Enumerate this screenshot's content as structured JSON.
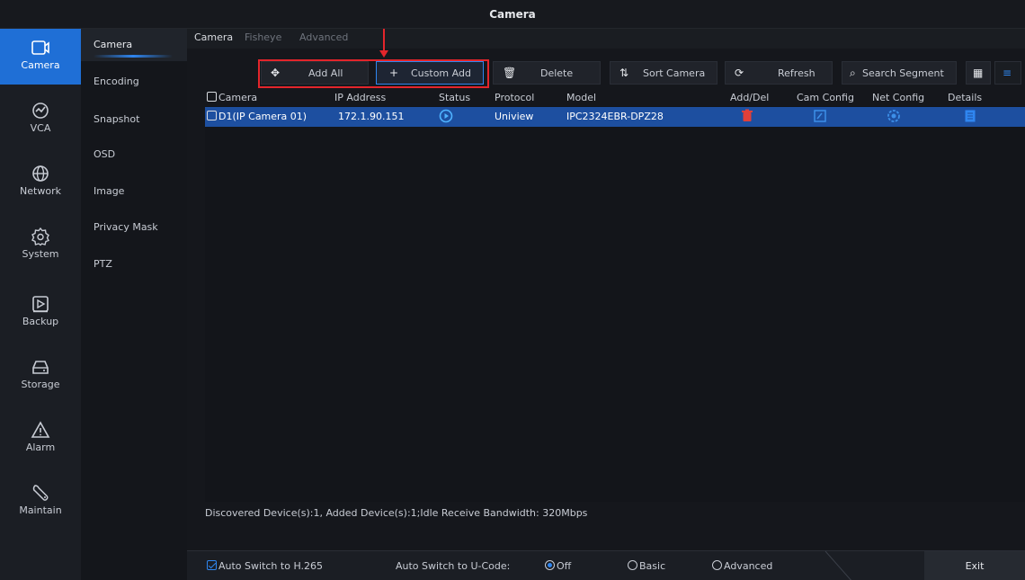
{
  "window": {
    "title": "Camera"
  },
  "nav": [
    {
      "label": "Camera",
      "icon": "camera-icon",
      "active": true
    },
    {
      "label": "VCA",
      "icon": "vca-icon"
    },
    {
      "label": "Network",
      "icon": "globe-icon"
    },
    {
      "label": "System",
      "icon": "gear-icon"
    },
    {
      "label": "Backup",
      "icon": "backup-icon"
    },
    {
      "label": "Storage",
      "icon": "hdd-icon"
    },
    {
      "label": "Alarm",
      "icon": "alarm-icon"
    },
    {
      "label": "Maintain",
      "icon": "wrench-icon"
    }
  ],
  "submenu": [
    "Camera",
    "Encoding",
    "Snapshot",
    "OSD",
    "Image",
    "Privacy Mask",
    "PTZ"
  ],
  "tabs": [
    "Camera",
    "Fisheye",
    "Advanced"
  ],
  "toolbar": {
    "add_all": "Add All",
    "custom_add": "Custom Add",
    "delete": "Delete",
    "sort_camera": "Sort Camera",
    "refresh": "Refresh",
    "search_segment": "Search Segment"
  },
  "columns": {
    "camera": "Camera",
    "ip": "IP Address",
    "status": "Status",
    "protocol": "Protocol",
    "model": "Model",
    "adddel": "Add/Del",
    "camconfig": "Cam Config",
    "netconfig": "Net Config",
    "details": "Details"
  },
  "rows": [
    {
      "camera": "D1(IP Camera 01)",
      "ip": "172.1.90.151",
      "protocol": "Uniview",
      "model": "IPC2324EBR-DPZ28"
    }
  ],
  "footer_info": "Discovered Device(s):1, Added Device(s):1;Idle Receive Bandwidth: 320Mbps",
  "bottom": {
    "auto_h265": "Auto Switch to H.265",
    "auto_ucode": "Auto Switch to U-Code:",
    "off": "Off",
    "basic": "Basic",
    "advanced": "Advanced",
    "exit": "Exit"
  },
  "colors": {
    "accent": "#1f6fd6",
    "highlight_box": "#e3252b",
    "row_selected": "#1d4fa0",
    "delete_icon": "#e0403a"
  }
}
